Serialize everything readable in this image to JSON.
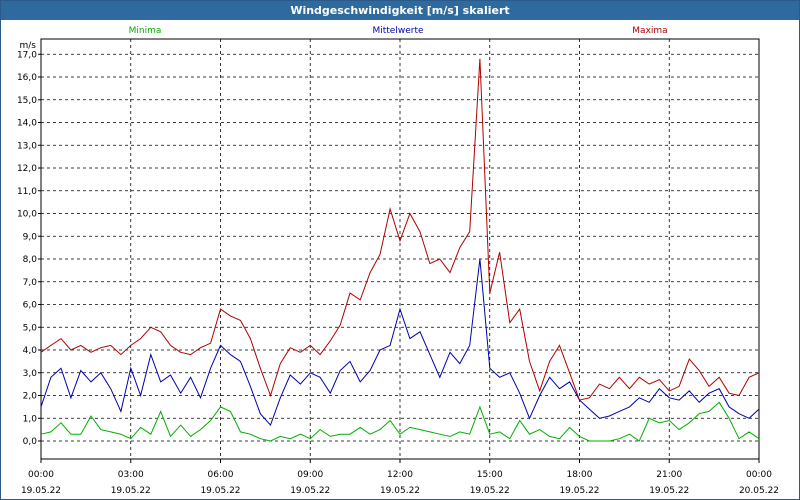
{
  "window": {
    "title": "Windgeschwindigkeit [m/s] skaliert"
  },
  "chart_data": {
    "type": "line",
    "title": "Windgeschwindigkeit [m/s] skaliert",
    "ylabel": "m/s",
    "ylim": [
      0,
      17
    ],
    "y_ticks": [
      "0,0",
      "1,0",
      "2,0",
      "3,0",
      "4,0",
      "5,0",
      "6,0",
      "7,0",
      "8,0",
      "9,0",
      "10,0",
      "11,0",
      "12,0",
      "13,0",
      "14,0",
      "15,0",
      "16,0",
      "17,0"
    ],
    "x_ticks": [
      {
        "time": "00:00",
        "date": "19.05.22"
      },
      {
        "time": "03:00",
        "date": "19.05.22"
      },
      {
        "time": "06:00",
        "date": "19.05.22"
      },
      {
        "time": "09:00",
        "date": "19.05.22"
      },
      {
        "time": "12:00",
        "date": "19.05.22"
      },
      {
        "time": "15:00",
        "date": "19.05.22"
      },
      {
        "time": "18:00",
        "date": "19.05.22"
      },
      {
        "time": "21:00",
        "date": "19.05.22"
      },
      {
        "time": "00:00",
        "date": "20.05.22"
      }
    ],
    "x_unit": "hours since 19.05.22 00:00",
    "grid": true,
    "series": [
      {
        "name": "Minima",
        "color": "#00b000",
        "x": [
          0,
          0.33,
          0.67,
          1,
          1.33,
          1.67,
          2,
          2.33,
          2.67,
          3,
          3.33,
          3.67,
          4,
          4.33,
          4.67,
          5,
          5.33,
          5.67,
          6,
          6.33,
          6.67,
          7,
          7.33,
          7.67,
          8,
          8.33,
          8.67,
          9,
          9.33,
          9.67,
          10,
          10.33,
          10.67,
          11,
          11.33,
          11.67,
          12,
          12.33,
          12.67,
          13,
          13.33,
          13.67,
          14,
          14.33,
          14.67,
          15,
          15.33,
          15.67,
          16,
          16.33,
          16.67,
          17,
          17.33,
          17.67,
          18,
          18.33,
          18.67,
          19,
          19.33,
          19.67,
          20,
          20.33,
          20.67,
          21,
          21.33,
          21.67,
          22,
          22.33,
          22.67,
          23,
          23.33,
          23.67,
          24
        ],
        "values": [
          0.3,
          0.4,
          0.8,
          0.3,
          0.3,
          1.1,
          0.5,
          0.4,
          0.3,
          0.1,
          0.6,
          0.3,
          1.3,
          0.2,
          0.7,
          0.2,
          0.5,
          0.9,
          1.5,
          1.3,
          0.4,
          0.3,
          0.1,
          0.0,
          0.2,
          0.1,
          0.3,
          0.1,
          0.5,
          0.2,
          0.3,
          0.3,
          0.6,
          0.3,
          0.5,
          0.9,
          0.3,
          0.6,
          0.5,
          0.4,
          0.3,
          0.2,
          0.4,
          0.3,
          1.5,
          0.3,
          0.4,
          0.1,
          0.9,
          0.3,
          0.5,
          0.2,
          0.1,
          0.6,
          0.2,
          0.0,
          0.0,
          0.0,
          0.1,
          0.3,
          0.0,
          1.0,
          0.8,
          0.9,
          0.5,
          0.8,
          1.2,
          1.3,
          1.7,
          1.0,
          0.1,
          0.4,
          0.1
        ]
      },
      {
        "name": "Mittelwerte",
        "color": "#0000b0",
        "x": [
          0,
          0.33,
          0.67,
          1,
          1.33,
          1.67,
          2,
          2.33,
          2.67,
          3,
          3.33,
          3.67,
          4,
          4.33,
          4.67,
          5,
          5.33,
          5.67,
          6,
          6.33,
          6.67,
          7,
          7.33,
          7.67,
          8,
          8.33,
          8.67,
          9,
          9.33,
          9.67,
          10,
          10.33,
          10.67,
          11,
          11.33,
          11.67,
          12,
          12.33,
          12.67,
          13,
          13.33,
          13.67,
          14,
          14.33,
          14.67,
          15,
          15.33,
          15.67,
          16,
          16.33,
          16.67,
          17,
          17.33,
          17.67,
          18,
          18.33,
          18.67,
          19,
          19.33,
          19.67,
          20,
          20.33,
          20.67,
          21,
          21.33,
          21.67,
          22,
          22.33,
          22.67,
          23,
          23.33,
          23.67,
          24
        ],
        "values": [
          1.5,
          2.8,
          3.2,
          1.9,
          3.1,
          2.6,
          3.0,
          2.3,
          1.3,
          3.2,
          2.0,
          3.8,
          2.6,
          2.9,
          2.1,
          2.8,
          1.9,
          3.2,
          4.2,
          3.8,
          3.5,
          2.4,
          1.2,
          0.7,
          1.9,
          2.9,
          2.5,
          3.0,
          2.8,
          2.1,
          3.1,
          3.5,
          2.6,
          3.1,
          4.0,
          4.2,
          5.8,
          4.5,
          4.8,
          3.8,
          2.8,
          3.9,
          3.4,
          4.2,
          8.0,
          3.2,
          2.8,
          3.0,
          2.1,
          1.0,
          2.0,
          2.8,
          2.3,
          2.6,
          1.8,
          1.4,
          1.0,
          1.1,
          1.3,
          1.5,
          1.9,
          1.7,
          2.3,
          1.9,
          1.8,
          2.2,
          1.7,
          2.1,
          2.3,
          1.5,
          1.2,
          1.0,
          1.4
        ]
      },
      {
        "name": "Maxima",
        "color": "#b00000",
        "x": [
          0,
          0.33,
          0.67,
          1,
          1.33,
          1.67,
          2,
          2.33,
          2.67,
          3,
          3.33,
          3.67,
          4,
          4.33,
          4.67,
          5,
          5.33,
          5.67,
          6,
          6.33,
          6.67,
          7,
          7.33,
          7.67,
          8,
          8.33,
          8.67,
          9,
          9.33,
          9.67,
          10,
          10.33,
          10.67,
          11,
          11.33,
          11.67,
          12,
          12.33,
          12.67,
          13,
          13.33,
          13.67,
          14,
          14.33,
          14.67,
          15,
          15.33,
          15.67,
          16,
          16.33,
          16.67,
          17,
          17.33,
          17.67,
          18,
          18.33,
          18.67,
          19,
          19.33,
          19.67,
          20,
          20.33,
          20.67,
          21,
          21.33,
          21.67,
          22,
          22.33,
          22.67,
          23,
          23.33,
          23.67,
          24
        ],
        "values": [
          3.9,
          4.2,
          4.5,
          4.0,
          4.2,
          3.9,
          4.1,
          4.2,
          3.8,
          4.2,
          4.5,
          5.0,
          4.8,
          4.2,
          3.9,
          3.8,
          4.1,
          4.3,
          5.8,
          5.5,
          5.3,
          4.5,
          3.2,
          2.0,
          3.4,
          4.1,
          3.9,
          4.2,
          3.8,
          4.4,
          5.1,
          6.5,
          6.2,
          7.4,
          8.2,
          10.2,
          8.8,
          10.0,
          9.2,
          7.8,
          8.0,
          7.4,
          8.5,
          9.2,
          16.8,
          6.5,
          8.3,
          5.2,
          5.8,
          3.5,
          2.2,
          3.5,
          4.2,
          3.0,
          1.8,
          1.9,
          2.5,
          2.3,
          2.8,
          2.3,
          2.8,
          2.5,
          2.7,
          2.2,
          2.4,
          3.6,
          3.1,
          2.4,
          2.8,
          2.1,
          2.0,
          2.8,
          3.0
        ]
      }
    ]
  }
}
